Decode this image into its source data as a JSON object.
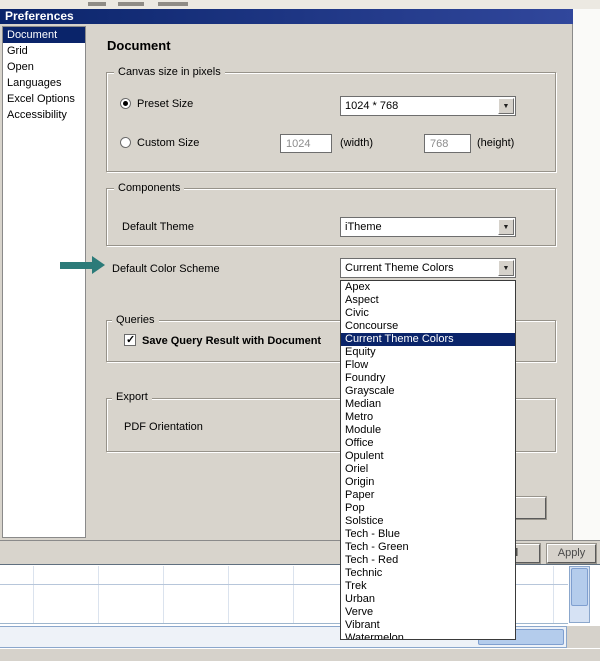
{
  "window": {
    "title": "Preferences"
  },
  "sidebar": {
    "items": [
      {
        "label": "Document",
        "selected": true
      },
      {
        "label": "Grid",
        "selected": false
      },
      {
        "label": "Open",
        "selected": false
      },
      {
        "label": "Languages",
        "selected": false
      },
      {
        "label": "Excel Options",
        "selected": false
      },
      {
        "label": "Accessibility",
        "selected": false
      }
    ]
  },
  "panel": {
    "heading": "Document",
    "canvas": {
      "legend": "Canvas size in pixels",
      "preset_label": "Preset Size",
      "preset_selected": true,
      "preset_value": "1024 * 768",
      "custom_label": "Custom Size",
      "custom_selected": false,
      "width_value": "1024",
      "width_caption": "(width)",
      "height_value": "768",
      "height_caption": "(height)"
    },
    "components": {
      "legend": "Components",
      "theme_label": "Default Theme",
      "theme_value": "iTheme",
      "scheme_label": "Default Color Scheme",
      "scheme_value": "Current Theme Colors"
    },
    "queries": {
      "legend": "Queries",
      "checkbox_label": "Save Query Result with Document",
      "checked": true
    },
    "export": {
      "legend": "Export",
      "pdf_label": "PDF Orientation"
    }
  },
  "scheme_dropdown": {
    "selected": "Current Theme Colors",
    "options": [
      "Apex",
      "Aspect",
      "Civic",
      "Concourse",
      "Current Theme Colors",
      "Equity",
      "Flow",
      "Foundry",
      "Grayscale",
      "Median",
      "Metro",
      "Module",
      "Office",
      "Opulent",
      "Oriel",
      "Origin",
      "Paper",
      "Pop",
      "Solstice",
      "Tech - Blue",
      "Tech - Green",
      "Tech - Red",
      "Technic",
      "Trek",
      "Urban",
      "Verve",
      "Vibrant",
      "Watermelon"
    ]
  },
  "buttons": {
    "cancel": "Cancel",
    "apply": "Apply"
  },
  "colors": {
    "titlebar": "#0a246a",
    "selection": "#0a246a",
    "dialog": "#d8d4cc",
    "arrow": "#2c7b79",
    "scroll_thumb": "#b4ccec"
  }
}
